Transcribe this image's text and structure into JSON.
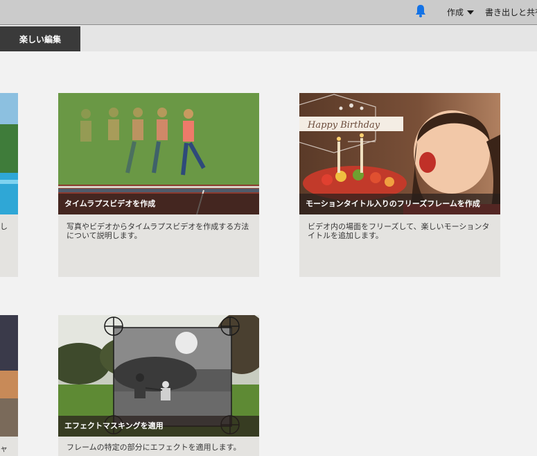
{
  "header": {
    "notification_icon": "bell-icon",
    "accent_color": "#1473e6",
    "create_label": "作成",
    "share_label": "書き出しと共有"
  },
  "tabs": {
    "active_label": "楽しい編集"
  },
  "cards": [
    {
      "title": "タイムラプスビデオを作成",
      "description": "写真やビデオからタイムラプスビデオを作成する方法について説明します。"
    },
    {
      "title": "モーションタイトル入りのフリーズフレームを作成",
      "description": "ビデオ内の場面をフリーズして、楽しいモーションタイトルを追加します。",
      "overlay_text": "Happy Birthday"
    },
    {
      "title": "エフェクトマスキングを適用",
      "description": "フレームの特定の部分にエフェクトを適用します。"
    }
  ],
  "partial_cards": {
    "top_desc_fragment": "し",
    "bottom_desc_fragment": "ャ"
  }
}
